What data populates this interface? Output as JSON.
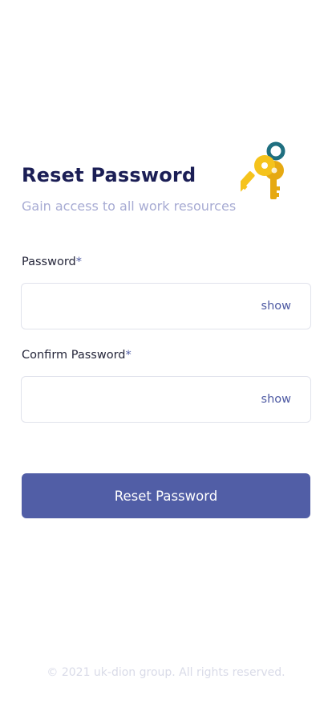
{
  "header": {
    "title": "Reset Password",
    "subtitle": "Gain access to all work resources",
    "illustration": "keys-icon"
  },
  "form": {
    "password": {
      "label": "Password",
      "required_mark": "*",
      "value": "",
      "toggle_label": "show"
    },
    "confirm_password": {
      "label": "Confirm Password",
      "required_mark": "*",
      "value": "",
      "toggle_label": "show"
    },
    "submit_label": "Reset Password"
  },
  "footer": {
    "copyright": "© 2021 uk-dion group. All rights reserved."
  },
  "colors": {
    "title": "#1b1e55",
    "subtitle": "#a7abd3",
    "accent": "#515ea6",
    "key_gold": "#f5c31c",
    "key_ring": "#1f6f80"
  }
}
